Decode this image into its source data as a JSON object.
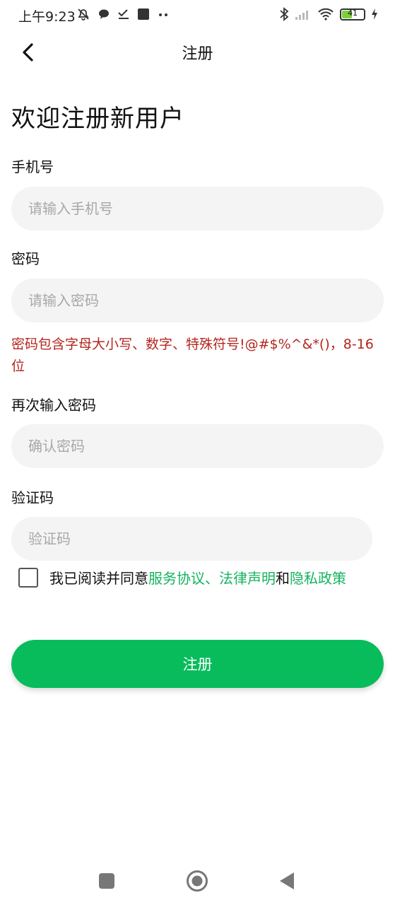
{
  "status_bar": {
    "time": "上午9:23",
    "left_icons": [
      "muted-bell-icon",
      "chat-bubble-icon",
      "check-lines-icon",
      "square-icon",
      "more-dots-icon"
    ],
    "right_icons": [
      "bluetooth-icon",
      "signal-icon",
      "wifi-icon",
      "battery-icon",
      "charging-icon"
    ],
    "battery_level": "41"
  },
  "header": {
    "title": "注册"
  },
  "welcome": "欢迎注册新用户",
  "form": {
    "phone": {
      "label": "手机号",
      "placeholder": "请输入手机号",
      "value": ""
    },
    "password": {
      "label": "密码",
      "placeholder": "请输入密码",
      "value": ""
    },
    "password_hint": "密码包含字母大小写、数字、特殊符号!@#$%^&*()，8-16位",
    "confirm": {
      "label": "再次输入密码",
      "placeholder": "确认密码",
      "value": ""
    },
    "code": {
      "label": "验证码",
      "placeholder": "验证码",
      "value": ""
    }
  },
  "agreement": {
    "prefix": "我已阅读并同意",
    "service": "服务协议",
    "sep": "、",
    "legal": "法律声明",
    "and": "和",
    "privacy": "隐私政策"
  },
  "register_button": "注册",
  "colors": {
    "accent": "#08bc5c",
    "link": "#15b35f",
    "hint": "#b3261e",
    "input_bg": "#f4f4f4"
  }
}
